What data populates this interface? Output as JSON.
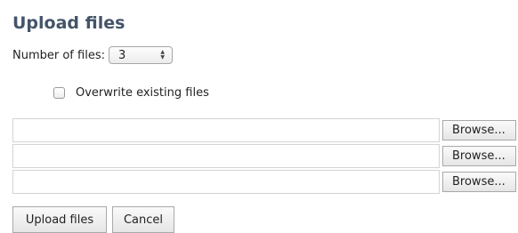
{
  "dialog": {
    "title": "Upload files",
    "count_label": "Number of files:",
    "count_value": "3",
    "overwrite_label": "Overwrite existing files",
    "overwrite_checked": false
  },
  "file_rows": [
    {
      "value": "",
      "browse_label": "Browse..."
    },
    {
      "value": "",
      "browse_label": "Browse..."
    },
    {
      "value": "",
      "browse_label": "Browse..."
    }
  ],
  "actions": {
    "upload_label": "Upload files",
    "cancel_label": "Cancel"
  },
  "colors": {
    "title": "#44546a",
    "field_border": "#d4d4d4",
    "button_border": "#a9a9a9"
  }
}
